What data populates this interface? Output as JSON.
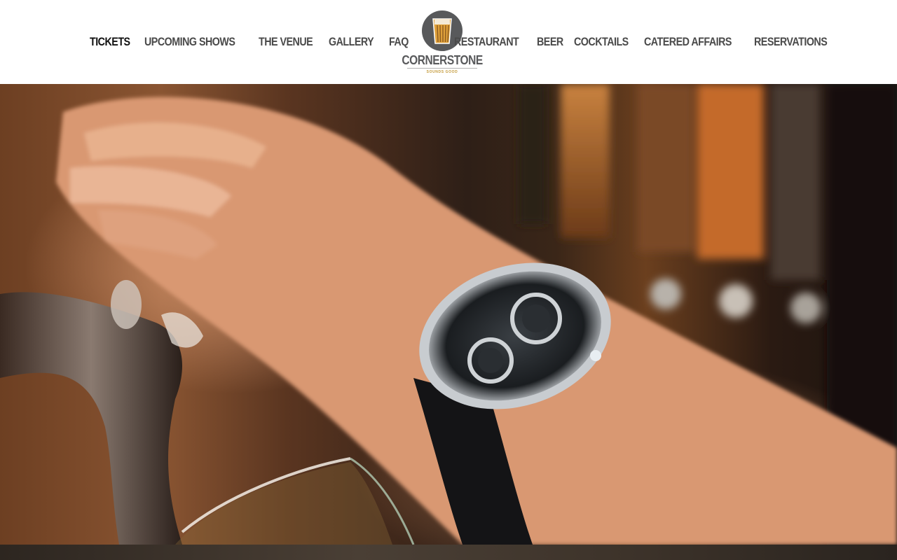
{
  "header": {
    "nav_left": [
      {
        "label": "TICKETS",
        "active": true
      },
      {
        "label": "UPCOMING SHOWS",
        "active": false
      },
      {
        "label": "THE VENUE",
        "active": false
      },
      {
        "label": "GALLERY",
        "active": false
      },
      {
        "label": "FAQ",
        "active": false
      }
    ],
    "nav_right": [
      {
        "label": "RESTAURANT"
      },
      {
        "label": "BEER"
      },
      {
        "label": "COCKTAILS"
      },
      {
        "label": "CATERED AFFAIRS"
      },
      {
        "label": "RESERVATIONS"
      }
    ],
    "logo": {
      "name": "CORNERSTONE",
      "tagline": "SOUNDS GOOD",
      "icon": "pint-glass-icon"
    }
  },
  "colors": {
    "nav_text": "#4a4a4a",
    "nav_active": "#111111",
    "logo_gray": "#58595b",
    "logo_gold": "#c49a3a",
    "beer_gold": "#e0a13a"
  },
  "hero": {
    "image": "bartender-pouring-beer-at-tap"
  }
}
